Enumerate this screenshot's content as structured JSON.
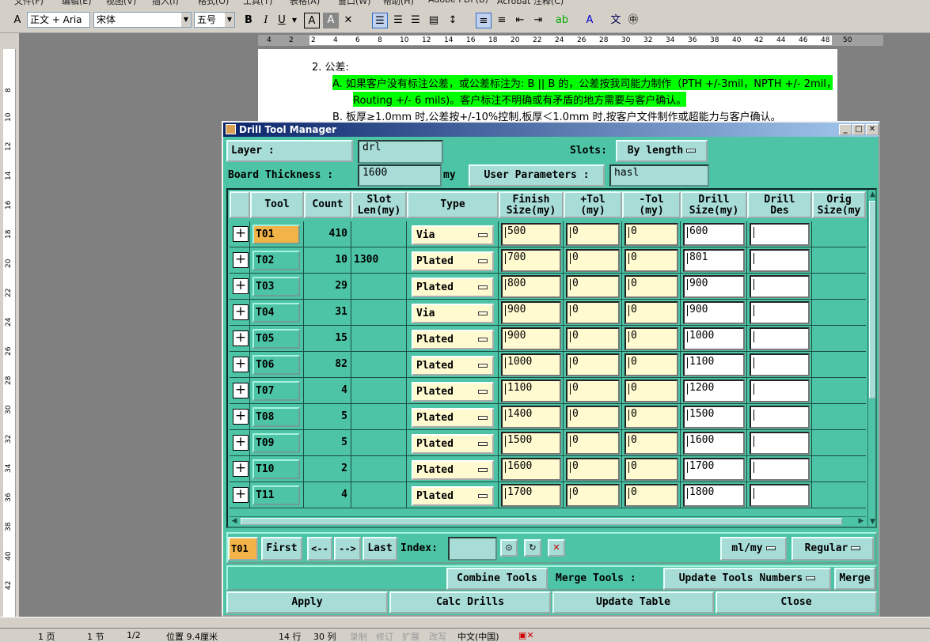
{
  "word": {
    "menu": [
      "文件(F)",
      "编辑(E)",
      "视图(V)",
      "插入(I)",
      "格式(O)",
      "工具(T)",
      "表格(A)",
      "窗口(W)",
      "帮助(H)",
      "Adobe PDF(B)",
      "Acrobat 注释(C)"
    ],
    "style_combo": "正文 + Aria",
    "font_combo": "宋体",
    "size_combo": "五号",
    "ruler_ticks": [
      "4",
      "2",
      "2",
      "4",
      "6",
      "8",
      "10",
      "12",
      "14",
      "16",
      "18",
      "20",
      "22",
      "24",
      "26",
      "28",
      "30",
      "32",
      "34",
      "36",
      "38",
      "40",
      "42",
      "44",
      "46",
      "48",
      "50"
    ],
    "vruler_ticks": [
      "8",
      "10",
      "12",
      "14",
      "16",
      "18",
      "20",
      "22",
      "24",
      "26",
      "28",
      "30",
      "32",
      "34",
      "36",
      "38",
      "40",
      "42"
    ],
    "doc_lines": {
      "heading": "2.  公差:",
      "a1": "A.  如果客户没有标注公差，或公差标注为: B || B 的，公差按我司能力制作（PTH +/-3mil，NPTH +/- 2mil，",
      "a2": "Routing +/- 6 mils)。客户标注不明确或有矛盾的地方需要与客户确认。",
      "b1": "B.  板厚≥1.0mm 时,公差按+/-10%控制,板厚＜1.0mm 时,按客户文件制作或超能力与客户确认。"
    },
    "status": {
      "page": "1 页",
      "section": "1 节",
      "pages": "1/2",
      "position": "位置 9.4厘米",
      "line": "14 行",
      "col": "30 列",
      "rec": "录制",
      "trk": "修订",
      "ext": "扩展",
      "ovr": "改写",
      "lang": "中文(中国)"
    }
  },
  "dtm": {
    "title": "Drill Tool Manager",
    "layer_label": "Layer              :",
    "layer_value": "drl",
    "slots_label": "Slots:",
    "slots_value": "By length",
    "thickness_label": "Board Thickness :",
    "thickness_value": "1600",
    "thickness_unit": "my",
    "user_params_label": "User Parameters :",
    "user_params_value": "hasl",
    "headers": {
      "tool": "Tool",
      "count": "Count",
      "slot_len_1": "Slot",
      "slot_len_2": "Len(my)",
      "type": "Type",
      "finish_1": "Finish",
      "finish_2": "Size(my)",
      "ptol_1": "+Tol",
      "ptol_2": "(my)",
      "ntol_1": "-Tol",
      "ntol_2": "(my)",
      "drill_1": "Drill",
      "drill_2": "Size(my)",
      "des_1": "Drill",
      "des_2": "Des",
      "orig_1": "Orig",
      "orig_2": "Size(my"
    },
    "rows": [
      {
        "tool": "T01",
        "count": "410",
        "slot": "",
        "type": "Via",
        "finish": "500",
        "ptol": "0",
        "ntol": "0",
        "drill": "600",
        "des": "",
        "selected": true
      },
      {
        "tool": "T02",
        "count": "10",
        "slot": "1300",
        "type": "Plated",
        "finish": "700",
        "ptol": "0",
        "ntol": "0",
        "drill": "801",
        "des": ""
      },
      {
        "tool": "T03",
        "count": "29",
        "slot": "",
        "type": "Plated",
        "finish": "800",
        "ptol": "0",
        "ntol": "0",
        "drill": "900",
        "des": ""
      },
      {
        "tool": "T04",
        "count": "31",
        "slot": "",
        "type": "Via",
        "finish": "900",
        "ptol": "0",
        "ntol": "0",
        "drill": "900",
        "des": ""
      },
      {
        "tool": "T05",
        "count": "15",
        "slot": "",
        "type": "Plated",
        "finish": "900",
        "ptol": "0",
        "ntol": "0",
        "drill": "1000",
        "des": ""
      },
      {
        "tool": "T06",
        "count": "82",
        "slot": "",
        "type": "Plated",
        "finish": "1000",
        "ptol": "0",
        "ntol": "0",
        "drill": "1100",
        "des": ""
      },
      {
        "tool": "T07",
        "count": "4",
        "slot": "",
        "type": "Plated",
        "finish": "1100",
        "ptol": "0",
        "ntol": "0",
        "drill": "1200",
        "des": ""
      },
      {
        "tool": "T08",
        "count": "5",
        "slot": "",
        "type": "Plated",
        "finish": "1400",
        "ptol": "0",
        "ntol": "0",
        "drill": "1500",
        "des": ""
      },
      {
        "tool": "T09",
        "count": "5",
        "slot": "",
        "type": "Plated",
        "finish": "1500",
        "ptol": "0",
        "ntol": "0",
        "drill": "1600",
        "des": ""
      },
      {
        "tool": "T10",
        "count": "2",
        "slot": "",
        "type": "Plated",
        "finish": "1600",
        "ptol": "0",
        "ntol": "0",
        "drill": "1700",
        "des": ""
      },
      {
        "tool": "T11",
        "count": "4",
        "slot": "",
        "type": "Plated",
        "finish": "1700",
        "ptol": "0",
        "ntol": "0",
        "drill": "1800",
        "des": ""
      }
    ],
    "nav": {
      "current": "T01",
      "first": "First",
      "prev": "<--",
      "next": "-->",
      "last": "Last",
      "index_label": "Index:",
      "index_value": "",
      "units": "ml/my",
      "mode": "Regular"
    },
    "actions": {
      "combine": "Combine Tools",
      "merge_label": "Merge Tools :",
      "merge_option": "Update Tools Numbers",
      "merge": "Merge"
    },
    "bottom": {
      "apply": "Apply",
      "calc": "Calc Drills",
      "update": "Update Table",
      "close": "Close"
    }
  }
}
